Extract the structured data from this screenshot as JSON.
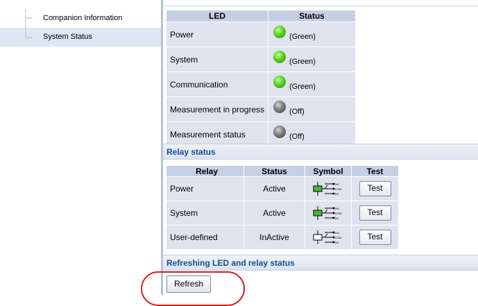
{
  "sidebar": {
    "items": [
      {
        "label": "Companion Information",
        "selected": false
      },
      {
        "label": "System Status",
        "selected": true
      }
    ]
  },
  "led_table": {
    "headers": [
      "LED",
      "Status"
    ],
    "rows": [
      {
        "name": "Power",
        "state": "green",
        "status_text": "(Green)"
      },
      {
        "name": "System",
        "state": "green",
        "status_text": "(Green)"
      },
      {
        "name": "Communication",
        "state": "green",
        "status_text": "(Green)"
      },
      {
        "name": "Measurement in progress",
        "state": "off",
        "status_text": "(Off)"
      },
      {
        "name": "Measurement status",
        "state": "off",
        "status_text": "(Off)"
      }
    ]
  },
  "relay_section": {
    "title": "Relay status",
    "headers": [
      "Relay",
      "Status",
      "Symbol",
      "Test"
    ],
    "rows": [
      {
        "relay": "Power",
        "status": "Active",
        "symbol": "relay-active-icon",
        "test_label": "Test"
      },
      {
        "relay": "System",
        "status": "Active",
        "symbol": "relay-active-icon",
        "test_label": "Test"
      },
      {
        "relay": "User-defined",
        "status": "InActive",
        "symbol": "relay-inactive-icon",
        "test_label": "Test"
      }
    ],
    "symbol_labels": [
      "NO",
      "COM",
      "NC"
    ]
  },
  "refresh_section": {
    "title": "Refreshing LED and relay status",
    "button_label": "Refresh"
  },
  "colors": {
    "accent_text": "#1f4a8c",
    "header_bg": "#c6d0e4",
    "cell_bg": "#dfe3ee",
    "led_green": "#56d11f",
    "led_off": "#7c7c7c",
    "relay_active": "#3fbf2a",
    "highlight": "#d21b1b"
  }
}
